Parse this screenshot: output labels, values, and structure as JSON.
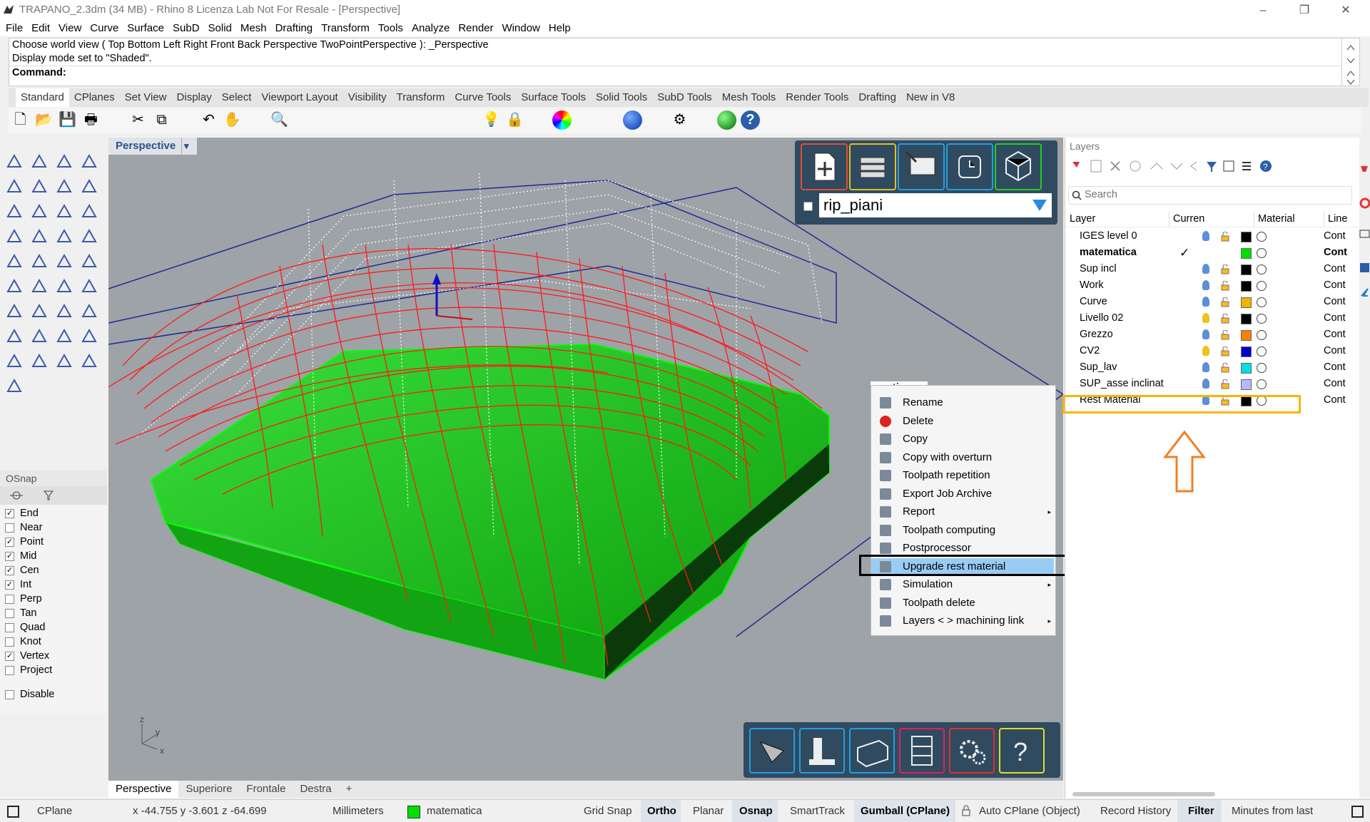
{
  "window": {
    "title": "TRAPANO_2.3dm (34 MB) - Rhino 8 Licenza Lab Not For Resale - [Perspective]",
    "minimize": "–",
    "restore": "❐",
    "close": "✕"
  },
  "menu": [
    "File",
    "Edit",
    "View",
    "Curve",
    "Surface",
    "SubD",
    "Solid",
    "Mesh",
    "Drafting",
    "Transform",
    "Tools",
    "Analyze",
    "Render",
    "Window",
    "Help"
  ],
  "command": {
    "history1": "Choose world view ( Top  Bottom  Left  Right  Front  Back  Perspective  TwoPointPerspective ): _Perspective",
    "history2": "Display mode set to \"Shaded\".",
    "prompt": "Command:"
  },
  "toolbar_tabs": [
    "Standard",
    "CPlanes",
    "Set View",
    "Display",
    "Select",
    "Viewport Layout",
    "Visibility",
    "Transform",
    "Curve Tools",
    "Surface Tools",
    "Solid Tools",
    "SubD Tools",
    "Mesh Tools",
    "Render Tools",
    "Drafting",
    "New in V8"
  ],
  "viewport": {
    "name": "Perspective",
    "dropdown": "▾",
    "cam_filter": "rip_piani",
    "bottom_tabs": [
      "Perspective",
      "Superiore",
      "Frontale",
      "Destra"
    ],
    "add_tab": "+",
    "partial_text": "ecution",
    "axis": {
      "z": "z",
      "y": "y",
      "x": "x"
    }
  },
  "context_menu": {
    "items": [
      {
        "label": "Rename",
        "submenu": false
      },
      {
        "label": "Delete",
        "submenu": false
      },
      {
        "label": "Copy",
        "submenu": false
      },
      {
        "label": "Copy with overturn",
        "submenu": false
      },
      {
        "label": "Toolpath repetition",
        "submenu": false
      },
      {
        "label": "Export Job Archive",
        "submenu": false
      },
      {
        "label": "Report",
        "submenu": true
      },
      {
        "label": "Toolpath computing",
        "submenu": false
      },
      {
        "label": "Postprocessor",
        "submenu": false
      },
      {
        "label": "Upgrade rest material",
        "submenu": false,
        "highlighted": true
      },
      {
        "label": "Simulation",
        "submenu": true
      },
      {
        "label": "Toolpath delete",
        "submenu": false
      },
      {
        "label": "Layers < > machining link",
        "submenu": true
      }
    ],
    "submenu_arrow": "▸"
  },
  "osnap": {
    "title": "OSnap",
    "items": [
      {
        "label": "End",
        "checked": true
      },
      {
        "label": "Near",
        "checked": false
      },
      {
        "label": "Point",
        "checked": true
      },
      {
        "label": "Mid",
        "checked": true
      },
      {
        "label": "Cen",
        "checked": true
      },
      {
        "label": "Int",
        "checked": true
      },
      {
        "label": "Perp",
        "checked": false
      },
      {
        "label": "Tan",
        "checked": false
      },
      {
        "label": "Quad",
        "checked": false
      },
      {
        "label": "Knot",
        "checked": false
      },
      {
        "label": "Vertex",
        "checked": true
      },
      {
        "label": "Project",
        "checked": false
      }
    ],
    "disable": "Disable",
    "check": "✓"
  },
  "layers": {
    "title": "Layers",
    "search_placeholder": "Search",
    "columns": {
      "layer": "Layer",
      "current": "Curren",
      "material": "Material",
      "linetype": "Line"
    },
    "rows": [
      {
        "name": "IGES level 0",
        "color": "#000000",
        "bulb": "#5b8fd6",
        "current": false,
        "linetype": "Cont"
      },
      {
        "name": "matematica",
        "color": "#00e000",
        "bulb": "",
        "current": true,
        "linetype": "Cont"
      },
      {
        "name": "Sup incl",
        "color": "#000000",
        "bulb": "#5b8fd6",
        "current": false,
        "linetype": "Cont"
      },
      {
        "name": "Work",
        "color": "#000000",
        "bulb": "#5b8fd6",
        "current": false,
        "linetype": "Cont"
      },
      {
        "name": "Curve",
        "color": "#f0b400",
        "bulb": "#5b8fd6",
        "current": false,
        "linetype": "Cont"
      },
      {
        "name": "Livello 02",
        "color": "#000000",
        "bulb": "#f0c020",
        "current": false,
        "linetype": "Cont"
      },
      {
        "name": "Grezzo",
        "color": "#ff7f00",
        "bulb": "#5b8fd6",
        "current": false,
        "linetype": "Cont"
      },
      {
        "name": "CV2",
        "color": "#0000d0",
        "bulb": "#f0c020",
        "current": false,
        "linetype": "Cont"
      },
      {
        "name": "Sup_lav",
        "color": "#00e0e0",
        "bulb": "#5b8fd6",
        "current": false,
        "linetype": "Cont"
      },
      {
        "name": "SUP_asse inclinato",
        "color": "#b8b8ff",
        "bulb": "#5b8fd6",
        "current": false,
        "linetype": "Cont"
      },
      {
        "name": "Rest Material",
        "color": "#000000",
        "bulb": "#5b8fd6",
        "current": false,
        "linetype": "Cont"
      }
    ],
    "checkmark": "✓"
  },
  "status": {
    "cplane": "CPlane",
    "coords": "x -44.755  y -3.601  z -64.699",
    "units": "Millimeters",
    "layer": "matematica",
    "layer_color": "#00e000",
    "grid_snap": "Grid Snap",
    "ortho": "Ortho",
    "planar": "Planar",
    "osnap": "Osnap",
    "smarttrack": "SmartTrack",
    "gumball": "Gumball (CPlane)",
    "autocplane": "Auto CPlane (Object)",
    "record_history": "Record History",
    "filter": "Filter",
    "minutes": "Minutes from last"
  },
  "colors": {
    "highlight_box": "#f7b500",
    "arrow": "#f08020",
    "menu_highlight": "#99ccf5",
    "viewport_bg": "#9ea3a8"
  }
}
